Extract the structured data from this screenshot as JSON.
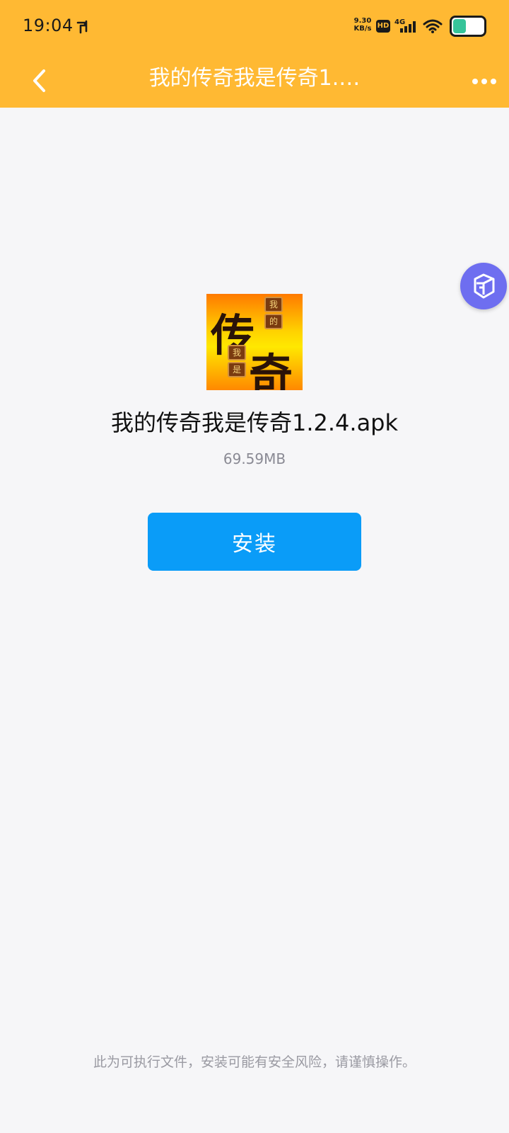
{
  "status_bar": {
    "time": "19:04",
    "net_speed_value": "9.30",
    "net_speed_unit": "KB/s",
    "hd_label": "HD",
    "network_label": "4G",
    "icons": [
      "carrier-icon",
      "hd-icon",
      "signal-icon",
      "wifi-icon",
      "battery-icon"
    ]
  },
  "nav": {
    "title": "我的传奇我是传奇1.…",
    "back_icon": "chevron-left-icon",
    "more_icon": "more-dots-icon"
  },
  "floating_button": {
    "icon": "cube-icon",
    "color": "#6e6ef0"
  },
  "app": {
    "icon_chars": {
      "char_a": "传",
      "char_b": "奇",
      "tag_1": "我",
      "tag_2": "的",
      "tag_3": "我",
      "tag_4": "是"
    },
    "file_name": "我的传奇我是传奇1.2.4.apk",
    "file_size": "69.59MB"
  },
  "actions": {
    "install_label": "安装"
  },
  "footer": {
    "warning": "此为可执行文件，安装可能有安全风险，请谨慎操作。"
  },
  "colors": {
    "header": "#ffb933",
    "background": "#f6f6f8",
    "primary_button": "#0a9cf8"
  }
}
